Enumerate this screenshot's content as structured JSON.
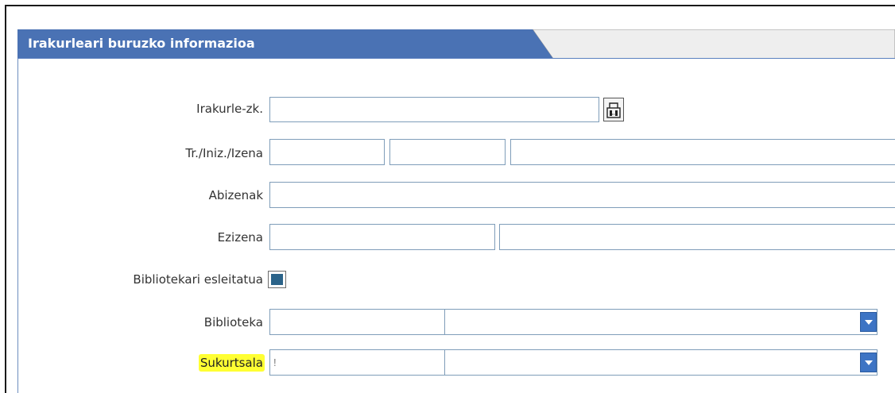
{
  "section": {
    "title": "Irakurleari buruzko informazioa"
  },
  "form": {
    "reader_number": {
      "label": "Irakurle-zk.",
      "value": ""
    },
    "title_initial_name": {
      "label": "Tr./Iniz./Izena",
      "title_value": "",
      "initial_value": "",
      "name_value": ""
    },
    "surnames": {
      "label": "Abizenak",
      "value": ""
    },
    "nickname": {
      "label": "Ezizena",
      "value_1": "",
      "value_2": ""
    },
    "assigned_librarian": {
      "label": "Bibliotekari esleitatua",
      "checked": true
    },
    "library": {
      "label": "Biblioteka",
      "code": "",
      "selected": ""
    },
    "branch": {
      "label": "Sukurtsala",
      "code": "!",
      "selected": "",
      "highlighted": true
    }
  },
  "colors": {
    "tab_blue": "#4a72b4",
    "tab_gray": "#eeeeee",
    "field_border": "#7f9db9",
    "highlight": "#ffff33",
    "checkbox_fill": "#2b6389",
    "combo_arrow": "#3d74c4"
  },
  "icons": {
    "lookup": "lookup-icon",
    "checkbox": "checkbox-icon",
    "dropdown": "chevron-down-icon"
  }
}
